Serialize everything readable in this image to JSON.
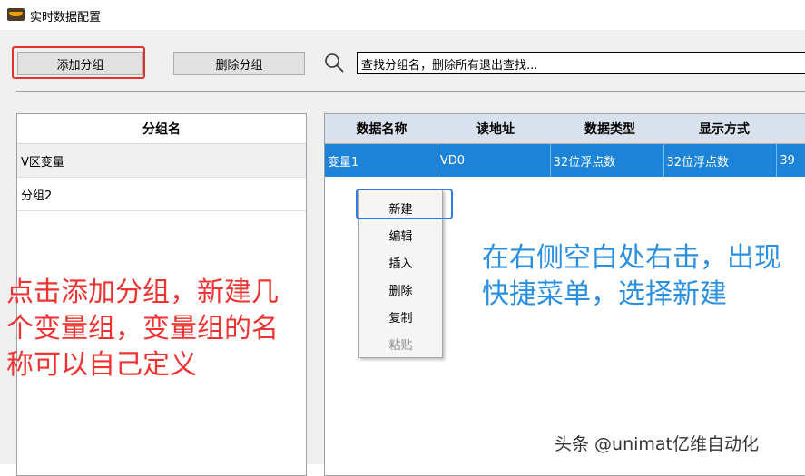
{
  "window": {
    "title": "实时数据配置",
    "icon": "app-icon"
  },
  "toolbar": {
    "add_group_label": "添加分组",
    "delete_group_label": "删除分组",
    "search_icon": "search-icon",
    "search_value": "查找分组名，删除所有退出查找..."
  },
  "group_table": {
    "header": "分组名",
    "rows": [
      "V区变量",
      "分组2"
    ]
  },
  "data_table": {
    "headers": [
      "数据名称",
      "读地址",
      "数据类型",
      "显示方式"
    ],
    "rows": [
      [
        "变量1",
        "VD0",
        "32位浮点数",
        "32位浮点数",
        "39"
      ]
    ]
  },
  "context_menu": {
    "items": [
      {
        "label": "新建",
        "enabled": true
      },
      {
        "label": "编辑",
        "enabled": true
      },
      {
        "label": "插入",
        "enabled": true
      },
      {
        "label": "删除",
        "enabled": true
      },
      {
        "label": "复制",
        "enabled": true
      },
      {
        "label": "粘贴",
        "enabled": false
      }
    ]
  },
  "annotations": {
    "left": "点击添加分组，新建几个变量组，变量组的名称可以自己定义",
    "right": "在右侧空白处右击，出现快捷菜单，选择新建",
    "watermark": "头条 @unimat亿维自动化"
  },
  "colors": {
    "highlight_red": "#e53030",
    "highlight_blue": "#2d7be5",
    "selected_row": "#1c84d8",
    "annotation_red": "#ee3333",
    "annotation_blue": "#2a8fe0"
  }
}
